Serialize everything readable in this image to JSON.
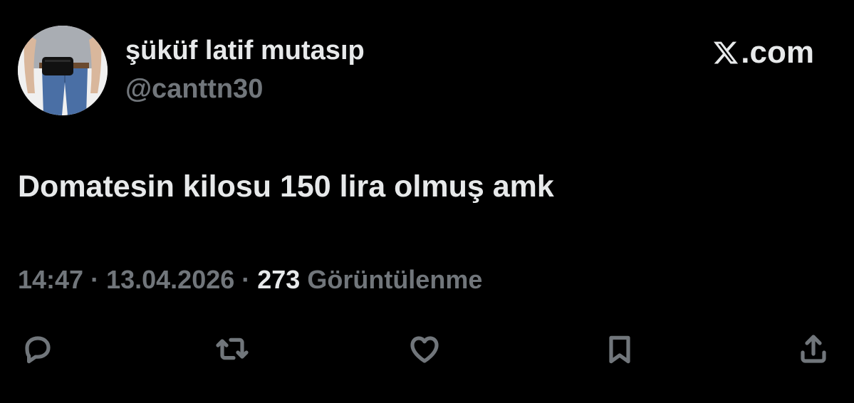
{
  "author": {
    "display_name": "şüküf latif mutasıp",
    "handle": "@canttn30",
    "avatar_icon": "avatar-photo"
  },
  "brand": {
    "text": ".com",
    "logo_icon": "x-logo-icon"
  },
  "tweet": {
    "text": "Domatesin kilosu 150 lira olmuş amk"
  },
  "meta": {
    "time": "14:47",
    "separator": " · ",
    "date": "13.04.2026",
    "views_count": "273",
    "views_label": " Görüntülenme"
  },
  "actions": [
    {
      "name": "reply",
      "icon": "reply-icon"
    },
    {
      "name": "repost",
      "icon": "repost-icon"
    },
    {
      "name": "like",
      "icon": "heart-icon"
    },
    {
      "name": "bookmark",
      "icon": "bookmark-icon"
    },
    {
      "name": "share",
      "icon": "share-icon"
    }
  ],
  "colors": {
    "background": "#000000",
    "primary_text": "#e7e9ea",
    "secondary_text": "#71767b"
  }
}
